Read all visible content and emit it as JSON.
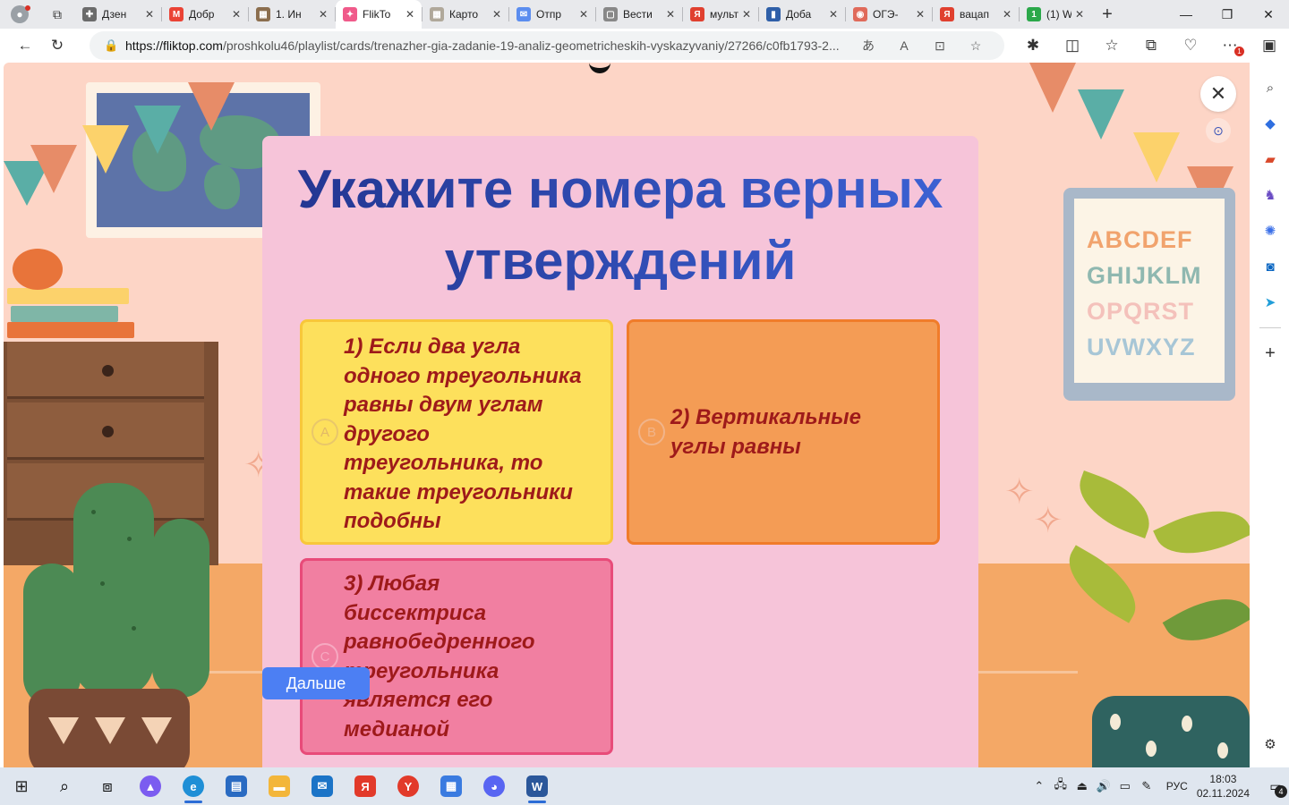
{
  "browser": {
    "tabs": [
      {
        "title": "Дзен",
        "favicon_color": "#6b6b6b",
        "favicon_glyph": "✚",
        "favicon_icon": "plus-icon"
      },
      {
        "title": "Добр",
        "favicon_color": "#ea4335",
        "favicon_glyph": "M",
        "favicon_icon": "gmail-icon"
      },
      {
        "title": "1. Ин",
        "favicon_color": "#8b6e4e",
        "favicon_glyph": "▦",
        "favicon_icon": "page-icon"
      },
      {
        "title": "FlikTo",
        "favicon_color": "#f05a8a",
        "favicon_glyph": "✦",
        "favicon_icon": "fliktop-icon",
        "active": true
      },
      {
        "title": "Карто",
        "favicon_color": "#b0a89a",
        "favicon_glyph": "▦",
        "favicon_icon": "page-icon"
      },
      {
        "title": "Отпр",
        "favicon_color": "#5b8def",
        "favicon_glyph": "✉",
        "favicon_icon": "mail-icon"
      },
      {
        "title": "Вести",
        "favicon_color": "#888888",
        "favicon_glyph": "▢",
        "favicon_icon": "document-icon"
      },
      {
        "title": "мульт",
        "favicon_color": "#e0402f",
        "favicon_glyph": "Я",
        "favicon_icon": "yandex-icon"
      },
      {
        "title": "Доба",
        "favicon_color": "#2f5fa8",
        "favicon_glyph": "▮",
        "favicon_icon": "book-icon"
      },
      {
        "title": "ОГЭ-",
        "favicon_color": "#e06a5a",
        "favicon_glyph": "◉",
        "favicon_icon": "circle-icon"
      },
      {
        "title": "вацап",
        "favicon_color": "#e0402f",
        "favicon_glyph": "Я",
        "favicon_icon": "yandex-icon"
      },
      {
        "title": "(1) W",
        "favicon_color": "#2ba84a",
        "favicon_glyph": "1",
        "favicon_icon": "whatsapp-icon"
      }
    ],
    "new_tab_glyph": "+",
    "url_domain": "https://fliktop.com",
    "url_path": "/proshkolu46/playlist/cards/trenazher-gia-zadanie-19-analiz-geometricheskih-vyskazyvaniy/27266/c0fb1793-2...",
    "notification_count": "1"
  },
  "quiz": {
    "title_line1": "Укажите номера верных",
    "title_line2": "утверждений",
    "options": [
      {
        "letter": "A",
        "text": "1) Если два угла одного треугольника равны двум углам другого треугольника, то такие треугольники подобны"
      },
      {
        "letter": "B",
        "text": "2) Вертикальные углы равны"
      },
      {
        "letter": "C",
        "text": "3) Любая биссектриса равнобедренного треугольника является его медианой"
      }
    ],
    "next_label": "Дальше"
  },
  "decor": {
    "alphabet_rows": [
      "ABCDEF",
      "GHIJKLM",
      "OPQRST",
      "UVWXYZ"
    ]
  },
  "taskbar": {
    "language": "РУС",
    "time": "18:03",
    "date": "02.11.2024",
    "notifications": "4"
  }
}
